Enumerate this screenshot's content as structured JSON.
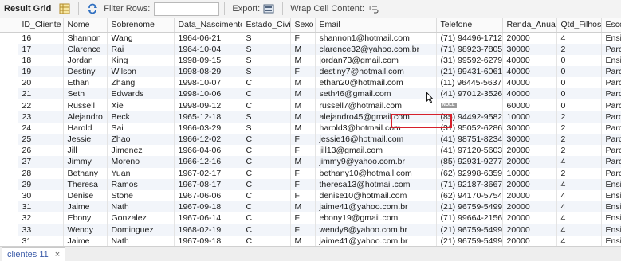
{
  "toolbar": {
    "result_grid_label": "Result Grid",
    "filter_rows_label": "Filter Rows:",
    "filter_value": "",
    "export_label": "Export:",
    "wrap_label": "Wrap Cell Content:"
  },
  "columns": [
    "ID_Cliente",
    "Nome",
    "Sobrenome",
    "Data_Nascimento",
    "Estado_Civil",
    "Sexo",
    "Email",
    "Telefone",
    "Renda_Anual",
    "Qtd_Filhos",
    "Escolaridade"
  ],
  "rows": [
    [
      "16",
      "Shannon",
      "Wang",
      "1964-06-21",
      "S",
      "F",
      "shannon1@hotmail.com",
      "(71) 94496-1712",
      "20000",
      "4",
      "Ensino médio"
    ],
    [
      "17",
      "Clarence",
      "Rai",
      "1964-10-04",
      "S",
      "M",
      "clarence32@yahoo.com.br",
      "(71) 98923-7805",
      "30000",
      "2",
      "Parcial"
    ],
    [
      "18",
      "Jordan",
      "King",
      "1998-09-15",
      "S",
      "M",
      "jordan73@gmail.com",
      "(31) 99592-6279",
      "40000",
      "0",
      "Ensino médio"
    ],
    [
      "19",
      "Destiny",
      "Wilson",
      "1998-08-29",
      "S",
      "F",
      "destiny7@hotmail.com",
      "(21) 99431-6061",
      "40000",
      "0",
      "Parcial"
    ],
    [
      "20",
      "Ethan",
      "Zhang",
      "1998-10-07",
      "C",
      "M",
      "ethan20@hotmail.com",
      "(11) 96445-5637",
      "40000",
      "0",
      "Parcial"
    ],
    [
      "21",
      "Seth",
      "Edwards",
      "1998-10-06",
      "C",
      "M",
      "seth46@gmail.com",
      "(41) 97012-3526",
      "40000",
      "0",
      "Parcial"
    ],
    [
      "22",
      "Russell",
      "Xie",
      "1998-09-12",
      "C",
      "M",
      "russell7@hotmail.com",
      "NULL",
      "60000",
      "0",
      "Parcial"
    ],
    [
      "23",
      "Alejandro",
      "Beck",
      "1965-12-18",
      "S",
      "M",
      "alejandro45@gmail.com",
      "(85) 94492-9582",
      "10000",
      "2",
      "Parcial"
    ],
    [
      "24",
      "Harold",
      "Sai",
      "1966-03-29",
      "S",
      "M",
      "harold3@hotmail.com",
      "(31) 95052-6286",
      "30000",
      "2",
      "Parcial"
    ],
    [
      "25",
      "Jessie",
      "Zhao",
      "1966-12-02",
      "C",
      "F",
      "jessie16@hotmail.com",
      "(41) 98751-8234",
      "30000",
      "2",
      "Parcial"
    ],
    [
      "26",
      "Jill",
      "Jimenez",
      "1966-04-06",
      "C",
      "F",
      "jill13@gmail.com",
      "(41) 97120-5603",
      "20000",
      "2",
      "Parcial"
    ],
    [
      "27",
      "Jimmy",
      "Moreno",
      "1966-12-16",
      "C",
      "M",
      "jimmy9@yahoo.com.br",
      "(85) 92931-9277",
      "20000",
      "4",
      "Parcial"
    ],
    [
      "28",
      "Bethany",
      "Yuan",
      "1967-02-17",
      "C",
      "F",
      "bethany10@hotmail.com",
      "(62) 92998-6359",
      "10000",
      "2",
      "Parcial"
    ],
    [
      "29",
      "Theresa",
      "Ramos",
      "1967-08-17",
      "C",
      "F",
      "theresa13@hotmail.com",
      "(71) 92187-3667",
      "20000",
      "4",
      "Ensino médio"
    ],
    [
      "30",
      "Denise",
      "Stone",
      "1967-06-06",
      "C",
      "F",
      "denise10@hotmail.com",
      "(62) 94170-5754",
      "20000",
      "4",
      "Ensino médio"
    ],
    [
      "31",
      "Jaime",
      "Nath",
      "1967-09-18",
      "C",
      "M",
      "jaime41@yahoo.com.br",
      "(21) 96759-5499",
      "20000",
      "4",
      "Ensino médio"
    ],
    [
      "32",
      "Ebony",
      "Gonzalez",
      "1967-06-14",
      "C",
      "F",
      "ebony19@gmail.com",
      "(71) 99664-2156",
      "20000",
      "4",
      "Ensino médio"
    ],
    [
      "33",
      "Wendy",
      "Dominguez",
      "1968-02-19",
      "C",
      "F",
      "wendy8@yahoo.com.br",
      "(21) 96759-5499",
      "20000",
      "4",
      "Ensino médio"
    ],
    [
      "31",
      "Jaime",
      "Nath",
      "1967-09-18",
      "C",
      "M",
      "jaime41@yahoo.com.br",
      "(21) 96759-5499",
      "20000",
      "4",
      "Ensino médio"
    ]
  ],
  "result_tab": {
    "label": "clientes 11",
    "close": "×"
  },
  "colors": {
    "highlight": "#d6202b",
    "row_alt": "#f2f5fa",
    "tab_text": "#3a5aa8"
  }
}
